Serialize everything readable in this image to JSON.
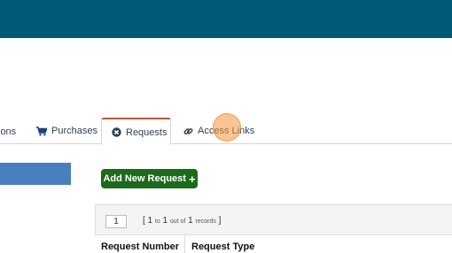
{
  "tabs": {
    "partial_label": "ions",
    "purchases": {
      "label": "Purchases",
      "icon": "cart-icon"
    },
    "requests": {
      "label": "Requests",
      "icon": "circle-x-icon",
      "active": true
    },
    "access_links": {
      "label": "Access Links",
      "icon": "link-icon"
    }
  },
  "actions": {
    "add_request_label": "Add New Request",
    "add_icon": "plus-icon"
  },
  "pager": {
    "page": "1",
    "bracket_open": "[",
    "from": "1",
    "to_word": "to",
    "to": "1",
    "of_text": "out of",
    "total": "1",
    "records_word": "records",
    "bracket_close": "]"
  },
  "table": {
    "columns": [
      "Request Number",
      "Request Type"
    ]
  },
  "colors": {
    "topbar": "#005a78",
    "active_tab_accent": "#b05a3c",
    "add_button": "#1c6a1c",
    "side_bar": "#4a7fbf"
  }
}
